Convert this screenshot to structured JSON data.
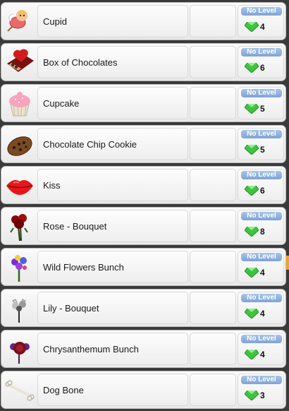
{
  "items": [
    {
      "name": "Cupid",
      "level": "No Level",
      "cost": "4",
      "icon": "cupid-icon"
    },
    {
      "name": "Box of Chocolates",
      "level": "No Level",
      "cost": "6",
      "icon": "chocolate-box-icon"
    },
    {
      "name": "Cupcake",
      "level": "No Level",
      "cost": "5",
      "icon": "cupcake-icon"
    },
    {
      "name": "Chocolate Chip Cookie",
      "level": "No Level",
      "cost": "5",
      "icon": "cookie-icon"
    },
    {
      "name": "Kiss",
      "level": "No Level",
      "cost": "6",
      "icon": "lips-icon"
    },
    {
      "name": "Rose - Bouquet",
      "level": "No Level",
      "cost": "8",
      "icon": "rose-bouquet-icon"
    },
    {
      "name": "Wild Flowers Bunch",
      "level": "No Level",
      "cost": "4",
      "icon": "wildflowers-icon"
    },
    {
      "name": "Lily - Bouquet",
      "level": "No Level",
      "cost": "4",
      "icon": "lily-bouquet-icon"
    },
    {
      "name": "Chrysanthemum Bunch",
      "level": "No Level",
      "cost": "4",
      "icon": "chrysanthemum-icon"
    },
    {
      "name": "Dog Bone",
      "level": "No Level",
      "cost": "3",
      "icon": "dog-bone-icon"
    }
  ],
  "colors": {
    "gem": "#3fc43f",
    "badge": "#8fb0de",
    "accent_chip": "#e9a536"
  }
}
